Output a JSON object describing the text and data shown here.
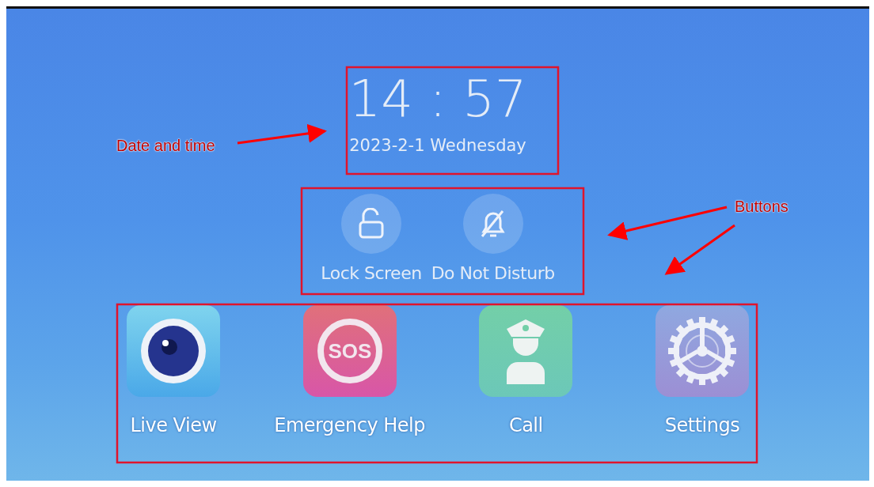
{
  "clock": {
    "time": "14 : 57",
    "date": "2023-2-1 Wednesday"
  },
  "quick_actions": [
    {
      "kind": "lock",
      "label": "Lock Screen"
    },
    {
      "kind": "mute",
      "label": "Do Not Disturb"
    }
  ],
  "apps": [
    {
      "kind": "camera",
      "label": "Live View"
    },
    {
      "kind": "sos",
      "label": "Emergency Help",
      "icon_text": "SOS"
    },
    {
      "kind": "police",
      "label": "Call"
    },
    {
      "kind": "gear",
      "label": "Settings"
    }
  ],
  "annotations": [
    {
      "label": "Date and time"
    },
    {
      "label": "Buttons"
    }
  ]
}
